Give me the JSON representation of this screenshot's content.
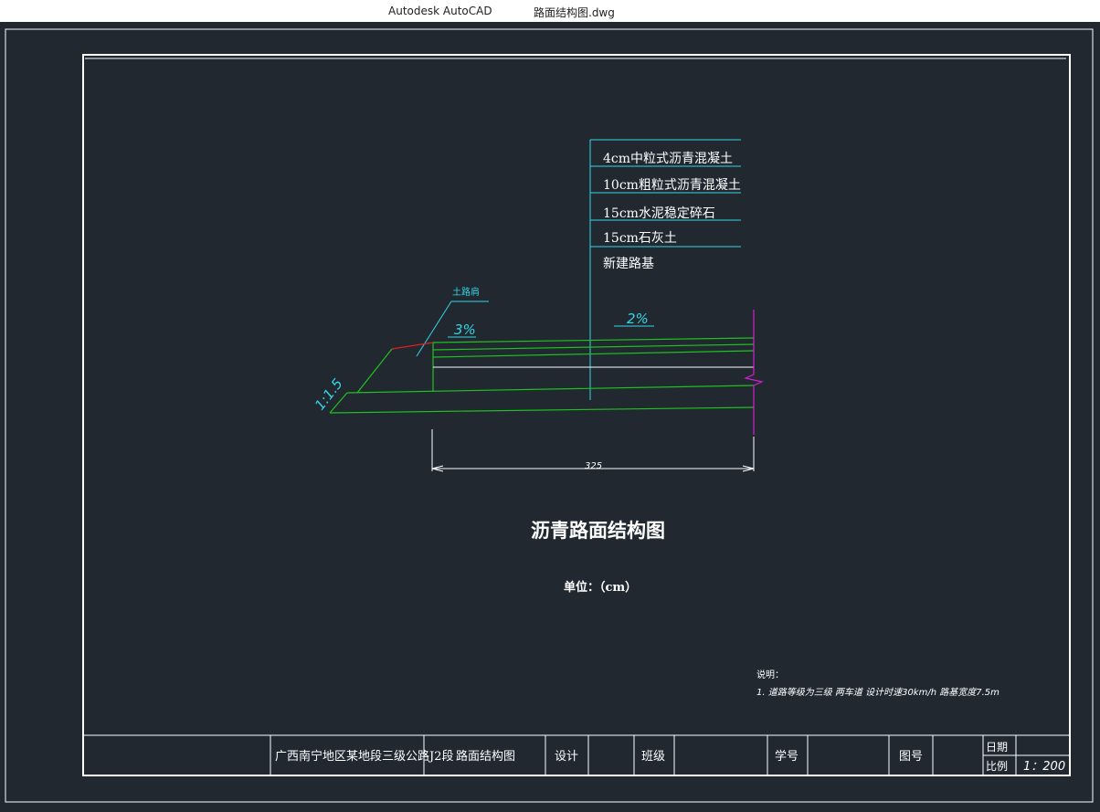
{
  "window": {
    "app_name": "Autodesk AutoCAD",
    "file_name": "路面结构图.dwg"
  },
  "colors": {
    "background": "#212830",
    "frame": "#ffffff",
    "cyan": "#33d6e6",
    "green": "#1fc21f",
    "red": "#e02020",
    "magenta": "#d020d0"
  },
  "drawing": {
    "layers": [
      "4cm中粒式沥青混凝土",
      "10cm粗粒式沥青混凝土",
      "15cm水泥稳定碎石",
      "15cm石灰土",
      "新建路基"
    ],
    "shoulder_label": "土路肩",
    "shoulder_slope": "3%",
    "road_slope": "2%",
    "side_slope": "1:1.5",
    "dimension": "325",
    "title": "沥青路面结构图",
    "unit": "单位：（cm）",
    "notes_title": "说明：",
    "notes_line": "1. 道路等级为三级  两车道  设计时速30km/h  路基宽度7.5m"
  },
  "title_block": {
    "project": "广西南宁地区某地段三级公路J2段",
    "drawing_name": "路面结构图",
    "design_label": "设计",
    "class_label": "班级",
    "student_id_label": "学号",
    "drawing_no_label": "图号",
    "date_label": "日期",
    "scale_label": "比例",
    "scale_value": "1：200"
  }
}
